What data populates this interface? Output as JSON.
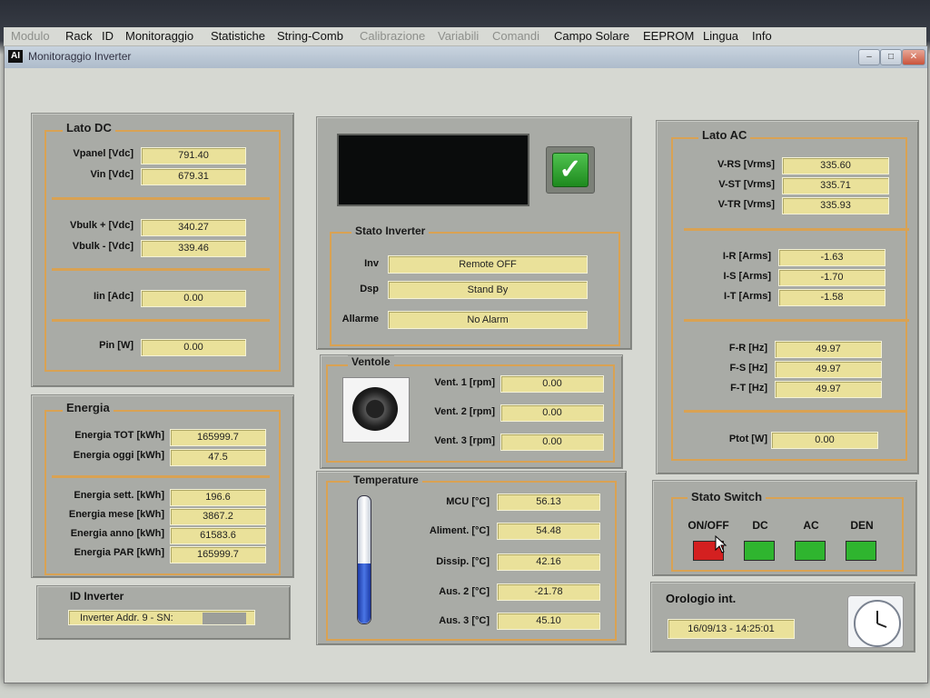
{
  "window": {
    "title": "Monitoraggio Inverter",
    "icon": "AI"
  },
  "menu": [
    "Modulo",
    "Rack",
    "ID",
    "Monitoraggio",
    "Statistiche",
    "String-Comb",
    "Calibrazione",
    "Variabili",
    "Comandi",
    "Campo Solare",
    "EEPROM",
    "Lingua",
    "Info"
  ],
  "lato_dc": {
    "title": "Lato DC",
    "vpanel": {
      "label": "Vpanel [Vdc]",
      "value": "791.40"
    },
    "vin": {
      "label": "Vin [Vdc]",
      "value": "679.31"
    },
    "vbulk_plus": {
      "label": "Vbulk + [Vdc]",
      "value": "340.27"
    },
    "vbulk_minus": {
      "label": "Vbulk - [Vdc]",
      "value": "339.46"
    },
    "iin": {
      "label": "Iin [Adc]",
      "value": "0.00"
    },
    "pin": {
      "label": "Pin [W]",
      "value": "0.00"
    }
  },
  "energia": {
    "title": "Energia",
    "tot": {
      "label": "Energia TOT [kWh]",
      "value": "165999.7"
    },
    "oggi": {
      "label": "Energia oggi [kWh]",
      "value": "47.5"
    },
    "sett": {
      "label": "Energia sett. [kWh]",
      "value": "196.6"
    },
    "mese": {
      "label": "Energia mese [kWh]",
      "value": "3867.2"
    },
    "anno": {
      "label": "Energia anno [kWh]",
      "value": "61583.6"
    },
    "par": {
      "label": "Energia PAR [kWh]",
      "value": "165999.7"
    }
  },
  "id_inverter": {
    "title": "ID Inverter",
    "value": "Inverter Addr. 9 - SN:"
  },
  "stato_inverter": {
    "title": "Stato Inverter",
    "inv": {
      "label": "Inv",
      "value": "Remote OFF"
    },
    "dsp": {
      "label": "Dsp",
      "value": "Stand By"
    },
    "allarme": {
      "label": "Allarme",
      "value": "No Alarm"
    },
    "ok_color": "#2aa52a"
  },
  "ventole": {
    "title": "Ventole",
    "v1": {
      "label": "Vent. 1 [rpm]",
      "value": "0.00"
    },
    "v2": {
      "label": "Vent. 2 [rpm]",
      "value": "0.00"
    },
    "v3": {
      "label": "Vent. 3 [rpm]",
      "value": "0.00"
    }
  },
  "temperature": {
    "title": "Temperature",
    "mcu": {
      "label": "MCU [°C]",
      "value": "56.13"
    },
    "aliment": {
      "label": "Aliment. [°C]",
      "value": "54.48"
    },
    "dissip": {
      "label": "Dissip. [°C]",
      "value": "42.16"
    },
    "aus2": {
      "label": "Aus. 2 [°C]",
      "value": "-21.78"
    },
    "aus3": {
      "label": "Aus. 3 [°C]",
      "value": "45.10"
    },
    "thermometer_level": 0.47
  },
  "lato_ac": {
    "title": "Lato AC",
    "vrs": {
      "label": "V-RS [Vrms]",
      "value": "335.60"
    },
    "vst": {
      "label": "V-ST [Vrms]",
      "value": "335.71"
    },
    "vtr": {
      "label": "V-TR [Vrms]",
      "value": "335.93"
    },
    "ir": {
      "label": "I-R [Arms]",
      "value": "-1.63"
    },
    "is": {
      "label": "I-S [Arms]",
      "value": "-1.70"
    },
    "it": {
      "label": "I-T [Arms]",
      "value": "-1.58"
    },
    "fr": {
      "label": "F-R [Hz]",
      "value": "49.97"
    },
    "fs": {
      "label": "F-S [Hz]",
      "value": "49.97"
    },
    "ft": {
      "label": "F-T [Hz]",
      "value": "49.97"
    },
    "ptot": {
      "label": "Ptot [W]",
      "value": "0.00"
    }
  },
  "stato_switch": {
    "title": "Stato Switch",
    "switches": [
      {
        "label": "ON/OFF",
        "color": "#d42020"
      },
      {
        "label": "DC",
        "color": "#2fb52f"
      },
      {
        "label": "AC",
        "color": "#2fb52f"
      },
      {
        "label": "DEN",
        "color": "#2fb52f"
      }
    ]
  },
  "orologio": {
    "title": "Orologio int.",
    "value": "16/09/13 - 14:25:01"
  },
  "colors": {
    "field": "#eae19a",
    "group_border": "#d9a253",
    "panel": "#a9aba6"
  }
}
